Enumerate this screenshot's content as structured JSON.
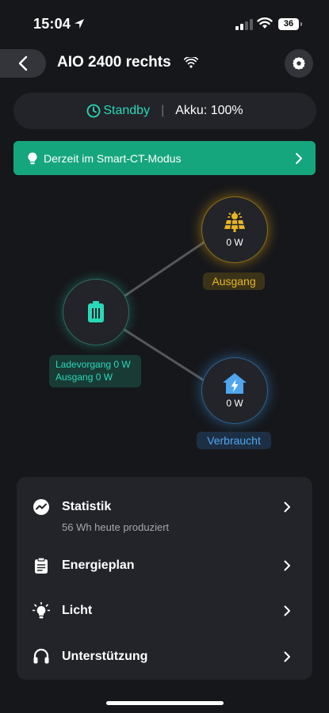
{
  "status_bar": {
    "time": "15:04",
    "battery_level": "36"
  },
  "header": {
    "title": "AIO 2400 rechts"
  },
  "status_pill": {
    "standby": "Standby",
    "divider": "|",
    "akku": "Akku: 100%"
  },
  "banner": {
    "text": "Derzeit im Smart-CT-Modus"
  },
  "flow": {
    "solar_value": "0 W",
    "solar_label": "Ausgang",
    "home_value": "0 W",
    "home_label": "Verbraucht",
    "battery_charge": "Ladevorgang  0 W",
    "battery_output": "Ausgang  0 W"
  },
  "menu": {
    "items": [
      {
        "label": "Statistik",
        "sub": "56 Wh heute produziert"
      },
      {
        "label": "Energieplan"
      },
      {
        "label": "Licht"
      },
      {
        "label": "Unterstützung"
      }
    ]
  },
  "colors": {
    "accent_teal": "#2ad8b9",
    "banner_green": "#16a67e",
    "solar_yellow": "#e9b623",
    "home_blue": "#4fa6ee",
    "background": "#16171b",
    "card": "#222429"
  }
}
